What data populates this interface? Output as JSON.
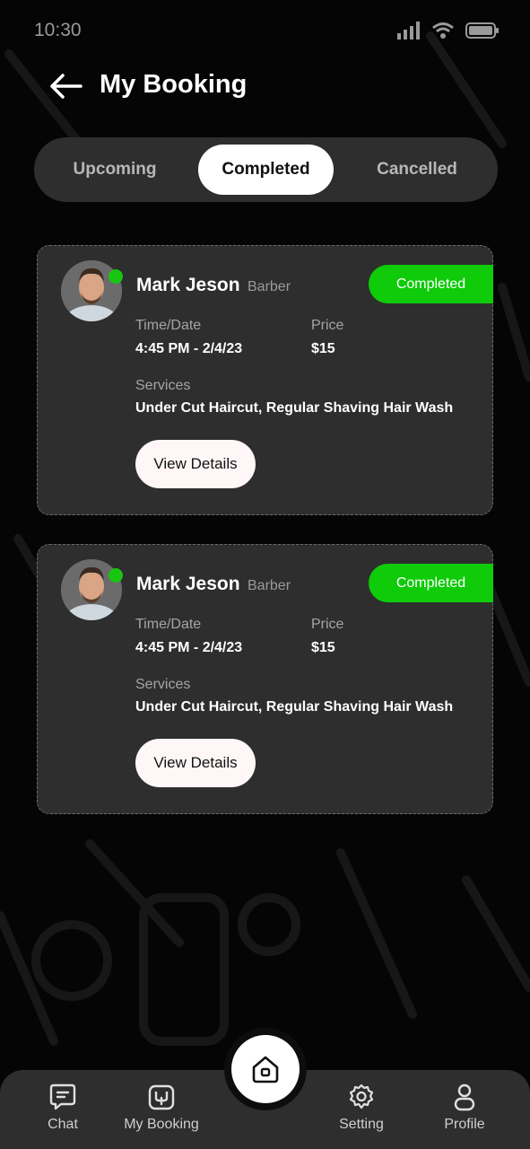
{
  "status_bar": {
    "time": "10:30"
  },
  "header": {
    "title": "My Booking"
  },
  "tabs": [
    {
      "label": "Upcoming",
      "active": false
    },
    {
      "label": "Completed",
      "active": true
    },
    {
      "label": "Cancelled",
      "active": false
    }
  ],
  "bookings": [
    {
      "name": "Mark Jeson",
      "role": "Barber",
      "status": "Completed",
      "time_label": "Time/Date",
      "time_value": "4:45 PM - 2/4/23",
      "price_label": "Price",
      "price_value": "$15",
      "services_label": "Services",
      "services_value": "Under Cut Haircut, Regular Shaving Hair Wash",
      "button_label": "View Details"
    },
    {
      "name": "Mark Jeson",
      "role": "Barber",
      "status": "Completed",
      "time_label": "Time/Date",
      "time_value": "4:45 PM - 2/4/23",
      "price_label": "Price",
      "price_value": "$15",
      "services_label": "Services",
      "services_value": "Under Cut Haircut, Regular Shaving Hair Wash",
      "button_label": "View Details"
    }
  ],
  "bottom_nav": {
    "items": [
      {
        "label": "Chat",
        "icon": "chat-icon"
      },
      {
        "label": "My Booking",
        "icon": "booking-icon"
      },
      {
        "label": "Setting",
        "icon": "gear-icon"
      },
      {
        "label": "Profile",
        "icon": "user-icon"
      }
    ],
    "home_icon": "home-icon"
  },
  "colors": {
    "background": "#050505",
    "card": "#2e2e2e",
    "accent_green": "#0fcb0a",
    "online_dot": "#18c511"
  }
}
